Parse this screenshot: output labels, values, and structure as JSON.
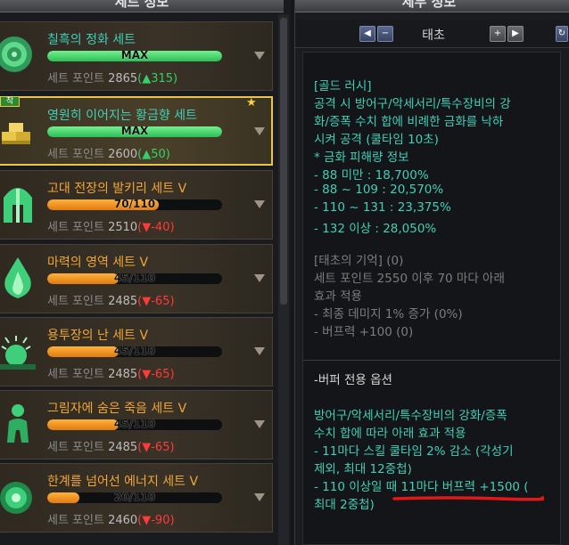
{
  "left": {
    "title": "세트 정보",
    "items": [
      {
        "name": "칠흑의 정화 세트",
        "bar_text": "MAX",
        "progress": 1.0,
        "points_label": "세트 포인트",
        "points": "2865",
        "delta": "▲315",
        "delta_dir": "up",
        "name_color": "teal",
        "icon": "rose-emblem-icon"
      },
      {
        "name": "영원히 이어지는 황금향 세트",
        "bar_text": "MAX",
        "progress": 1.0,
        "points_label": "세트 포인트",
        "points": "2600",
        "delta": "▲50",
        "delta_dir": "up",
        "name_color": "teal",
        "icon": "gold-bars-icon",
        "badge": "착",
        "selected": true
      },
      {
        "name": "고대 전장의 발키리 세트 V",
        "bar_text": "70/110",
        "progress": 0.636,
        "points_label": "세트 포인트",
        "points": "2510",
        "delta": "▼-40",
        "delta_dir": "down",
        "name_color": "orange",
        "icon": "valkyrie-helmet-icon"
      },
      {
        "name": "마력의 영역 세트 V",
        "bar_text": "45/110",
        "progress": 0.409,
        "points_label": "세트 포인트",
        "points": "2485",
        "delta": "▼-65",
        "delta_dir": "down",
        "name_color": "orange",
        "icon": "flame-icon"
      },
      {
        "name": "용투장의 난 세트 V",
        "bar_text": "45/110",
        "progress": 0.409,
        "points_label": "세트 포인트",
        "points": "2485",
        "delta": "▼-65",
        "delta_dir": "down",
        "name_color": "orange",
        "icon": "sunburst-icon"
      },
      {
        "name": "그림자에 숨은 죽음 세트 V",
        "bar_text": "45/110",
        "progress": 0.409,
        "points_label": "세트 포인트",
        "points": "2485",
        "delta": "▼-65",
        "delta_dir": "down",
        "name_color": "orange",
        "icon": "shadow-figure-icon"
      },
      {
        "name": "한계를 넘어선 에너지 세트 V",
        "bar_text": "20/110",
        "progress": 0.182,
        "points_label": "세트 포인트",
        "points": "2460",
        "delta": "▼-90",
        "delta_dir": "down",
        "name_color": "orange",
        "icon": "energy-orb-icon"
      }
    ]
  },
  "right": {
    "title": "세부 정보",
    "nav_title": "태초",
    "lines": [
      {
        "text": "[골드 러시]",
        "color": "teal"
      },
      {
        "text": "공격 시 방어구/악세서리/특수장비의 강",
        "color": "teal"
      },
      {
        "text": "화/증폭 수치 합에 비례한 금화를 낙하",
        "color": "teal"
      },
      {
        "text": "시켜 공격 (쿨타임 10초)",
        "color": "teal"
      },
      {
        "text": " * 금화 피해량 정보",
        "color": "teal"
      },
      {
        "text": "  - 88 미만 : 18,700%",
        "color": "teal"
      },
      {
        "text": "  - 88 ~ 109 : 20,570%",
        "color": "teal"
      },
      {
        "text": "  - 110 ~ 131 : 23,375%",
        "color": "teal"
      },
      {
        "text": "  - 132 이상 : 28,050%",
        "color": "teal"
      },
      {
        "text": "[태초의 기억] (0)",
        "color": "grey"
      },
      {
        "text": "세트 포인트 2550 이후 70 마다 아래",
        "color": "grey"
      },
      {
        "text": "효과 적용",
        "color": "grey"
      },
      {
        "text": "- 최종 데미지 1% 증가 (0%)",
        "color": "grey"
      },
      {
        "text": "- 버프력 +100 (0)",
        "color": "grey"
      },
      {
        "text": "-버퍼 전용 옵션",
        "color": "white"
      },
      {
        "text": "방어구/악세서리/특수장비의 강화/증폭",
        "color": "teal"
      },
      {
        "text": "수치 합에 따라 아래 효과 적용",
        "color": "teal"
      },
      {
        "text": "- 11마다 스킬 쿨타임 2% 감소 (각성기",
        "color": "teal"
      },
      {
        "text": "제외, 최대 12중첩)",
        "color": "teal"
      },
      {
        "text": "- 110 이상일 때 11마다 버프력 +1500 (",
        "color": "teal"
      },
      {
        "text": "최대 2중첩)",
        "color": "teal"
      }
    ]
  },
  "colors": {
    "teal": "#3fd0b8",
    "orange": "#f0a636",
    "gold_border": "#e8c64a",
    "up": "#34d06a",
    "down": "#ff3a3a",
    "underline": "#e01818"
  }
}
